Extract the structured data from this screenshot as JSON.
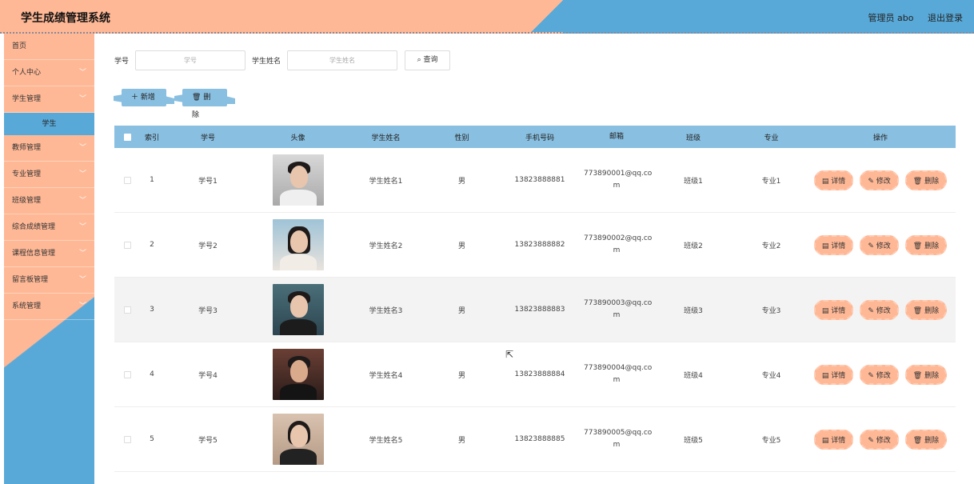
{
  "header": {
    "title": "学生成绩管理系统",
    "user_label": "管理员 abo",
    "logout_label": "退出登录"
  },
  "sidebar": {
    "items": [
      {
        "label": "首页",
        "has_arrow": false
      },
      {
        "label": "个人中心",
        "has_arrow": true
      },
      {
        "label": "学生管理",
        "has_arrow": true
      },
      {
        "label": "教师管理",
        "has_arrow": true
      },
      {
        "label": "专业管理",
        "has_arrow": true
      },
      {
        "label": "班级管理",
        "has_arrow": true
      },
      {
        "label": "综合成绩管理",
        "has_arrow": true
      },
      {
        "label": "课程信息管理",
        "has_arrow": true
      },
      {
        "label": "留言板管理",
        "has_arrow": true
      },
      {
        "label": "系统管理",
        "has_arrow": true
      }
    ],
    "sub_item": "学生"
  },
  "search": {
    "sno_label": "学号",
    "sno_placeholder": "学号",
    "name_label": "学生姓名",
    "name_placeholder": "学生姓名",
    "query_label": "查询"
  },
  "actions": {
    "add_label": "新增",
    "delete_label": "删除"
  },
  "table": {
    "headers": [
      "索引",
      "学号",
      "头像",
      "学生姓名",
      "性别",
      "手机号码",
      "邮箱",
      "班级",
      "专业",
      "操作"
    ],
    "rows": [
      {
        "idx": "1",
        "sno": "学号1",
        "name": "学生姓名1",
        "sex": "男",
        "phone": "13823888881",
        "mail_a": "773890001@qq.co",
        "mail_b": "m",
        "cls": "班级1",
        "major": "专业1"
      },
      {
        "idx": "2",
        "sno": "学号2",
        "name": "学生姓名2",
        "sex": "男",
        "phone": "13823888882",
        "mail_a": "773890002@qq.co",
        "mail_b": "m",
        "cls": "班级2",
        "major": "专业2"
      },
      {
        "idx": "3",
        "sno": "学号3",
        "name": "学生姓名3",
        "sex": "男",
        "phone": "13823888883",
        "mail_a": "773890003@qq.co",
        "mail_b": "m",
        "cls": "班级3",
        "major": "专业3"
      },
      {
        "idx": "4",
        "sno": "学号4",
        "name": "学生姓名4",
        "sex": "男",
        "phone": "13823888884",
        "mail_a": "773890004@qq.co",
        "mail_b": "m",
        "cls": "班级4",
        "major": "专业4"
      },
      {
        "idx": "5",
        "sno": "学号5",
        "name": "学生姓名5",
        "sex": "男",
        "phone": "13823888885",
        "mail_a": "773890005@qq.co",
        "mail_b": "m",
        "cls": "班级5",
        "major": "专业5"
      }
    ],
    "op_detail": "详情",
    "op_edit": "修改",
    "op_delete": "删除"
  },
  "colors": {
    "accent_peach": "#ffb896",
    "accent_blue": "#59a9d8",
    "table_header": "#89bfe0"
  }
}
